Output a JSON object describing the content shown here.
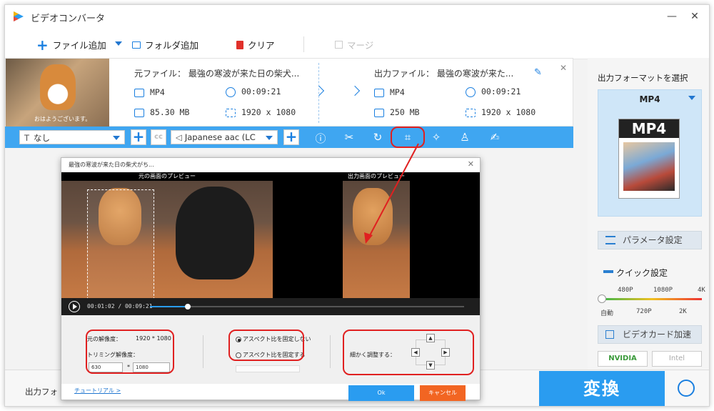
{
  "app": {
    "title": "ビデオコンバータ"
  },
  "toolbar": {
    "add_file": "ファイル追加",
    "add_folder": "フォルダ追加",
    "clear": "クリア",
    "merge": "マージ"
  },
  "file": {
    "source_label": "元ファイル：",
    "source_name": "最強の寒波が来た日の柴犬...",
    "output_label": "出力ファイル：",
    "output_name": "最強の寒波が来た...",
    "src_format": "MP4",
    "src_duration": "00:09:21",
    "src_size": "85.30 MB",
    "src_resolution": "1920 x 1080",
    "out_format": "MP4",
    "out_duration": "00:09:21",
    "out_size": "250 MB",
    "out_resolution": "1920 x 1080",
    "thumb_caption": "おはようございます。"
  },
  "editbar": {
    "subtitle": "なし",
    "audio": "Japanese aac (LC"
  },
  "right": {
    "select_format": "出力フォーマットを選択",
    "format": "MP4",
    "card_label": "MP4",
    "params": "パラメータ設定",
    "quick": "クイック設定",
    "res_top": [
      "480P",
      "1080P",
      "4K"
    ],
    "res_bottom": [
      "自動",
      "720P",
      "2K"
    ],
    "gpu_accel": "ビデオカード加速",
    "gpu1": "NVIDIA",
    "gpu2": "Intel"
  },
  "bottom": {
    "output_folder": "出力フォ",
    "convert": "変換"
  },
  "dialog": {
    "title": "最強の寒波が来た日の柴犬がち...",
    "original_preview": "元の画面のプレビュー",
    "output_preview": "出力画面のプレビュー",
    "time": "00:01:02 / 00:09:21",
    "progress": 0.12,
    "orig_res_label": "元の解像度：",
    "orig_res": "1920 * 1080",
    "trim_label": "トリミング解像度：",
    "trim_w": "630",
    "trim_sep": "*",
    "trim_h": "1080",
    "aspect_free": "アスペクト比を固定しない",
    "aspect_fixed": "アスペクト比を固定する",
    "fine_adjust": "細かく調整する：",
    "tutorial": "チュートリアル >",
    "ok": "Ok",
    "cancel": "キャンセル"
  }
}
